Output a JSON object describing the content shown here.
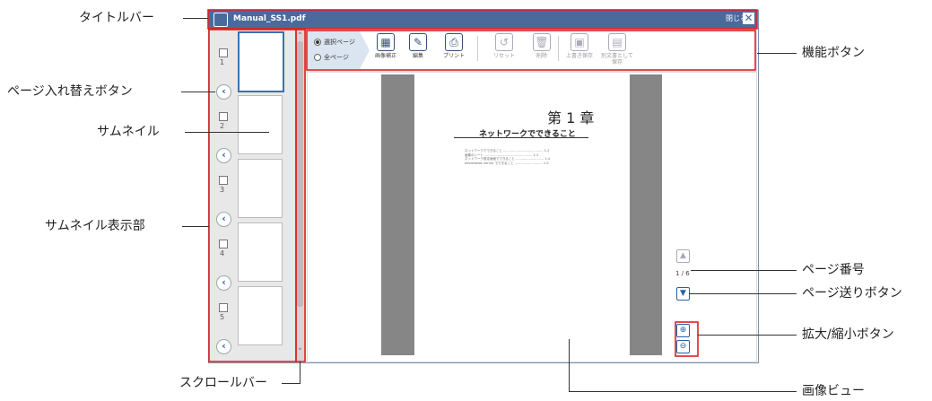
{
  "callouts": {
    "title_bar": "タイトルバー",
    "page_swap_button": "ページ入れ替えボタン",
    "thumbnail": "サムネイル",
    "thumbnail_area": "サムネイル表示部",
    "scrollbar": "スクロールバー",
    "function_buttons": "機能ボタン",
    "page_number": "ページ番号",
    "page_forward_button": "ページ送りボタン",
    "zoom_buttons": "拡大/縮小ボタン",
    "image_view": "画像ビュー"
  },
  "window": {
    "title": "Manual_SS1.pdf",
    "close_label": "閉じる"
  },
  "toolbar": {
    "scope_options": [
      "選択ページ",
      "全ページ"
    ],
    "selected_scope": 0,
    "tools": [
      {
        "label": "画像補正",
        "icon": "image-correct-icon",
        "enabled": true
      },
      {
        "label": "編集",
        "icon": "edit-icon",
        "enabled": true
      },
      {
        "label": "プリント",
        "icon": "print-icon",
        "enabled": true
      },
      {
        "label": "リセット",
        "icon": "reset-icon",
        "enabled": false
      },
      {
        "label": "削除",
        "icon": "delete-icon",
        "enabled": false
      },
      {
        "label": "上書き保存",
        "icon": "save-icon",
        "enabled": false
      },
      {
        "label": "別文書として\n保存",
        "icon": "save-as-icon",
        "enabled": false
      }
    ]
  },
  "thumbnails": [
    {
      "num": "1",
      "selected": true
    },
    {
      "num": "2",
      "selected": false
    },
    {
      "num": "3",
      "selected": false
    },
    {
      "num": "4",
      "selected": false
    },
    {
      "num": "5",
      "selected": false
    }
  ],
  "viewer": {
    "chapter": "第 1 章",
    "subtitle": "ネットワークでできること",
    "toc": [
      "ネットワークでできること ........................................ 1-2",
      "  画像のシート ................................................ 1-2",
      "  ネットワーク設定画面でできること ............................ 1-4",
      "  Information server でできること ............................ 1-5"
    ],
    "page_indicator": "1 / 6"
  },
  "colors": {
    "titlebar": "#4a6a9c",
    "accent": "#2a5fa5",
    "callout_border": "#e02020"
  }
}
